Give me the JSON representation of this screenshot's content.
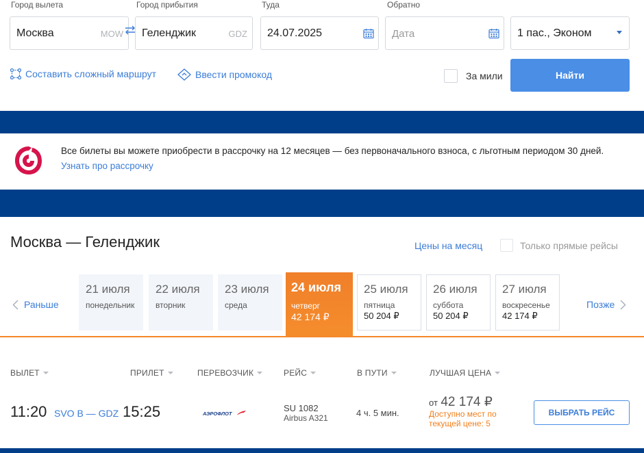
{
  "search": {
    "from_label": "Город вылета",
    "from_value": "Москва",
    "from_code": "MOW",
    "to_label": "Город прибытия",
    "to_value": "Геленджик",
    "to_code": "GDZ",
    "depart_label": "Туда",
    "depart_value": "24.07.2025",
    "return_label": "Обратно",
    "return_placeholder": "Дата",
    "passengers_value": "1 пас., Эконом",
    "complex_route_link": "Составить сложный маршрут",
    "promo_code_link": "Ввести промокод",
    "miles_label": "За мили",
    "find_button": "Найти"
  },
  "promo": {
    "text": "Все билеты вы можете приобрести в рассрочку на 12 месяцев — без первоначального взноса, с льготным периодом 30 дней.",
    "link": "Узнать про рассрочку"
  },
  "results": {
    "route_title": "Москва — Геленджик",
    "month_prices_link": "Цены на месяц",
    "direct_only_label": "Только прямые рейсы",
    "earlier": "Раньше",
    "later": "Позже",
    "days": [
      {
        "date": "21 июля",
        "weekday": "понедельник",
        "price": ""
      },
      {
        "date": "22 июля",
        "weekday": "вторник",
        "price": ""
      },
      {
        "date": "23 июля",
        "weekday": "среда",
        "price": ""
      },
      {
        "date": "24 июля",
        "weekday": "четверг",
        "price": "42 174 ₽"
      },
      {
        "date": "25 июля",
        "weekday": "пятница",
        "price": "50 204 ₽"
      },
      {
        "date": "26 июля",
        "weekday": "суббота",
        "price": "50 204 ₽"
      },
      {
        "date": "27 июля",
        "weekday": "воскресенье",
        "price": "42 174 ₽"
      }
    ],
    "selected_day_index": 3
  },
  "table": {
    "columns": [
      "ВЫЛЕТ",
      "ПРИЛЕТ",
      "ПЕРЕВОЗЧИК",
      "РЕЙС",
      "В ПУТИ",
      "ЛУЧШАЯ ЦЕНА"
    ],
    "flight": {
      "departure_time": "11:20",
      "route_codes": "SVO B — GDZ",
      "arrival_time": "15:25",
      "airline_logo_text": "АЭРОФЛОТ",
      "flight_number": "SU 1082",
      "aircraft": "Airbus A321",
      "duration": "4 ч. 5 мин.",
      "price_prefix": "от",
      "price": "42 174 ₽",
      "seats_line1": "Доступно мест по",
      "seats_line2": "текущей цене: 5",
      "select_button": "ВЫБРАТЬ РЕЙС"
    }
  },
  "colors": {
    "brand_blue": "#003e8a",
    "accent_blue": "#4a8ee6",
    "link_blue": "#3b7dd8",
    "selected_orange": "#f58d2c"
  }
}
